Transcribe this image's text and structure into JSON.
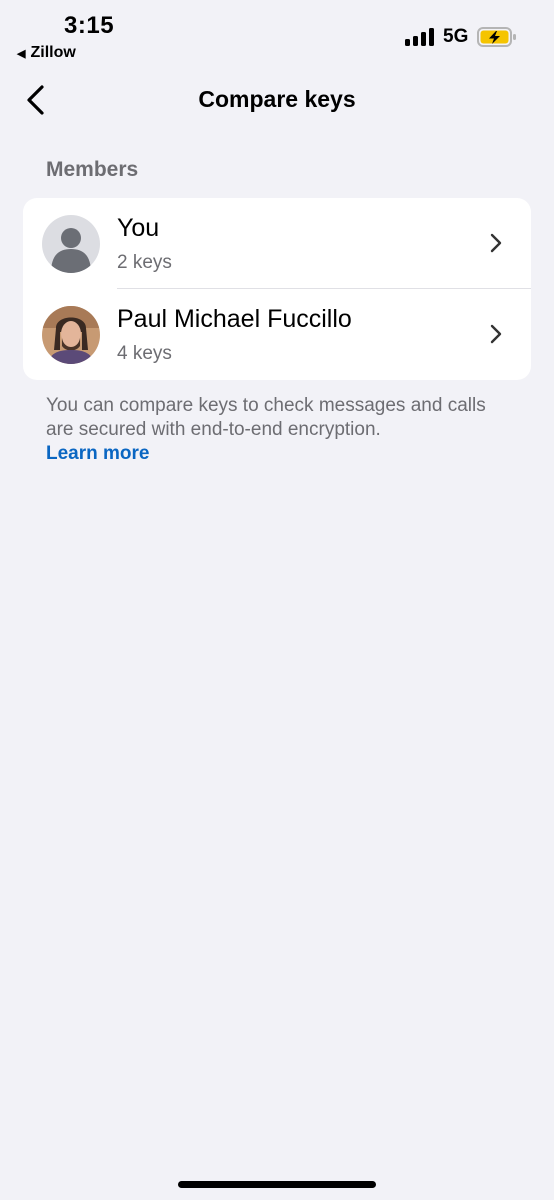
{
  "status_bar": {
    "time": "3:15",
    "back_app_label": "Zillow",
    "network": "5G",
    "battery_icon": "battery-charging-icon",
    "battery_color": "#f5c400"
  },
  "nav": {
    "title": "Compare keys",
    "back_icon": "chevron-left-icon"
  },
  "members": {
    "header": "Members",
    "items": [
      {
        "name": "You",
        "keys": "2 keys",
        "avatar": "default-avatar-icon"
      },
      {
        "name": "Paul Michael Fuccillo",
        "keys": "4 keys",
        "avatar": "profile-photo"
      }
    ]
  },
  "footer": {
    "text": "You can compare keys to check messages and calls are secured with end-to-end encryption.",
    "link": "Learn more",
    "link_color": "#0a66c2"
  }
}
